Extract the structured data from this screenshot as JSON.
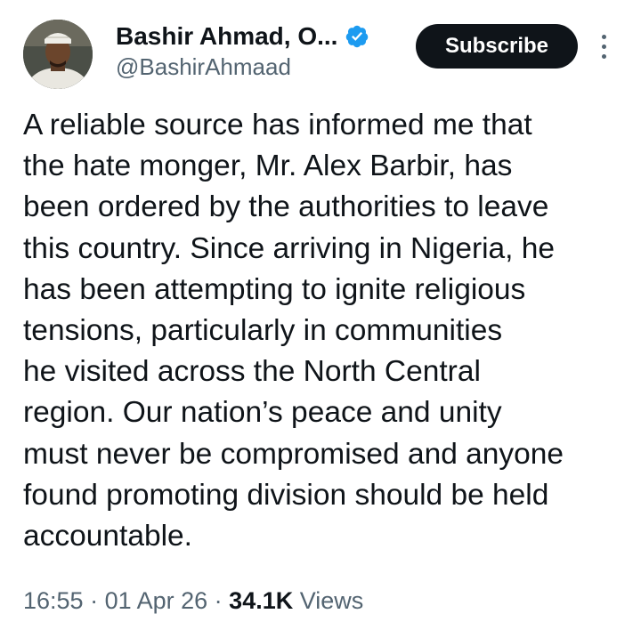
{
  "author": {
    "name": "Bashir Ahmad, O...",
    "handle": "@BashirAhmaad",
    "verified": true
  },
  "actions": {
    "subscribe_label": "Subscribe",
    "more_icon": "more-vertical-icon"
  },
  "tweet": {
    "lines": [
      "A reliable source has informed me that",
      "the hate monger, Mr. Alex Barbir, has",
      "been ordered by the authorities to leave",
      "this country. Since arriving in Nigeria, he",
      "has been attempting to ignite religious",
      "tensions, particularly in communities",
      "he visited across the North Central",
      "region. Our nation’s peace and unity",
      "must never be compromised and anyone",
      "found promoting division should be held",
      "accountable."
    ]
  },
  "meta": {
    "time": "16:55",
    "separator": " · ",
    "date": "01 Apr 26",
    "views_count": "34.1K",
    "views_label": " Views"
  },
  "colors": {
    "text_primary": "#0f1419",
    "text_secondary": "#536471",
    "verified_blue": "#1d9bf0",
    "button_bg": "#0f1419"
  }
}
